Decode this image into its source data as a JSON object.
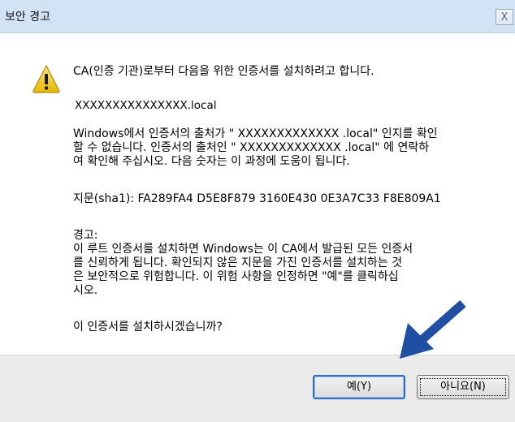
{
  "window": {
    "title": "보안 경고",
    "close_glyph": "X"
  },
  "message": {
    "intro": "CA(인증 기관)로부터 다음을 위한 인증서를 설치하려고 합니다.",
    "host": "XXXXXXXXXXXXXXX.local",
    "validation_line1": "Windows에서 인증서의 출처가 \" XXXXXXXXXXXXX .local\" 인지를 확인",
    "validation_line2": "할 수 없습니다. 인증서의 출처인 \" XXXXXXXXXXXXX .local\" 에 연락하",
    "validation_line3": "여 확인해 주십시오. 다음 숫자는 이 과정에 도움이 됩니다.",
    "thumbprint": "지문(sha1): FA289FA4 D5E8F879 3160E430 0E3A7C33 F8E809A1",
    "warning_heading": "경고:",
    "warning_line1": "이 루트 인증서를 설치하면 Windows는 이 CA에서 발급된 모든 인증서",
    "warning_line2": "를 신뢰하게 됩니다. 확인되지 않은 지문을 가진 인증서를 설치하는 것",
    "warning_line3": "은 보안적으로 위험합니다. 이 위험 사항을 인정하면 \"예\"를 클릭하십",
    "warning_line4": "시오.",
    "question": "이 인증서를 설치하시겠습니까?"
  },
  "buttons": {
    "yes_label": "예(Y)",
    "no_label": "아니요(N)"
  },
  "colors": {
    "titlebar": "#d3e3f6",
    "footer": "#ebebeb",
    "arrow": "#1f4fa3",
    "focus": "#2f6ec4"
  },
  "icons": {
    "warning": "warning-triangle-icon",
    "close": "close-icon",
    "pointer": "pointer-arrow-icon"
  }
}
